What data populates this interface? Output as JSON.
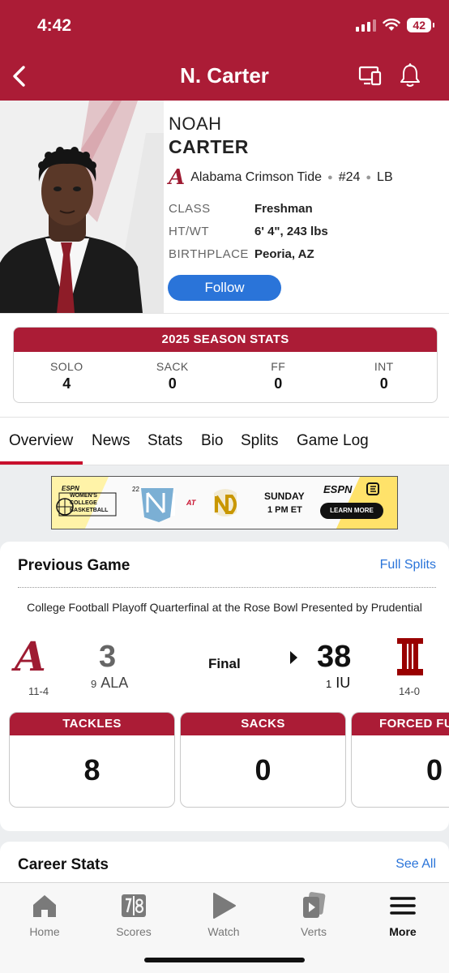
{
  "status_bar": {
    "time": "4:42",
    "battery": "42"
  },
  "header": {
    "title": "N. Carter"
  },
  "player": {
    "first_name": "NOAH",
    "last_name": "CARTER",
    "team": "Alabama Crimson Tide",
    "number": "#24",
    "position": "LB",
    "info": [
      {
        "label": "CLASS",
        "value": "Freshman"
      },
      {
        "label": "HT/WT",
        "value": "6' 4\", 243 lbs"
      },
      {
        "label": "BIRTHPLACE",
        "value": "Peoria, AZ"
      }
    ],
    "follow_label": "Follow"
  },
  "season_stats": {
    "title": "2025 SEASON STATS",
    "stats": [
      {
        "label": "SOLO",
        "value": "4"
      },
      {
        "label": "SACK",
        "value": "0"
      },
      {
        "label": "FF",
        "value": "0"
      },
      {
        "label": "INT",
        "value": "0"
      }
    ]
  },
  "tabs": [
    "Overview",
    "News",
    "Stats",
    "Bio",
    "Splits",
    "Game Log"
  ],
  "active_tab": "Overview",
  "ad": {
    "brand": "ESPN",
    "league": "WOMEN'S COLLEGE BASKETBALL",
    "rank": "22",
    "at": "AT",
    "day": "SUNDAY",
    "time": "1 PM ET",
    "cta": "LEARN MORE"
  },
  "previous_game": {
    "title": "Previous Game",
    "link": "Full Splits",
    "event": "College Football Playoff Quarterfinal at the Rose Bowl Presented by Prudential",
    "status": "Final",
    "away": {
      "record": "11-4",
      "score": "3",
      "rank": "9",
      "abbr": "ALA"
    },
    "home": {
      "record": "14-0",
      "score": "38",
      "rank": "1",
      "abbr": "IU"
    },
    "stats": [
      {
        "label": "TACKLES",
        "value": "8"
      },
      {
        "label": "SACKS",
        "value": "0"
      },
      {
        "label": "FORCED FU",
        "value": "0"
      }
    ]
  },
  "career": {
    "title": "Career Stats",
    "link": "See All"
  },
  "nav": [
    {
      "label": "Home",
      "icon": "home-icon"
    },
    {
      "label": "Scores",
      "icon": "scores-icon"
    },
    {
      "label": "Watch",
      "icon": "play-icon"
    },
    {
      "label": "Verts",
      "icon": "verts-icon"
    },
    {
      "label": "More",
      "icon": "menu-icon"
    }
  ],
  "colors": {
    "brand": "#ab1c36",
    "link": "#2a74d9",
    "follow": "#2a74d9",
    "crimson": "#9e1b32"
  }
}
